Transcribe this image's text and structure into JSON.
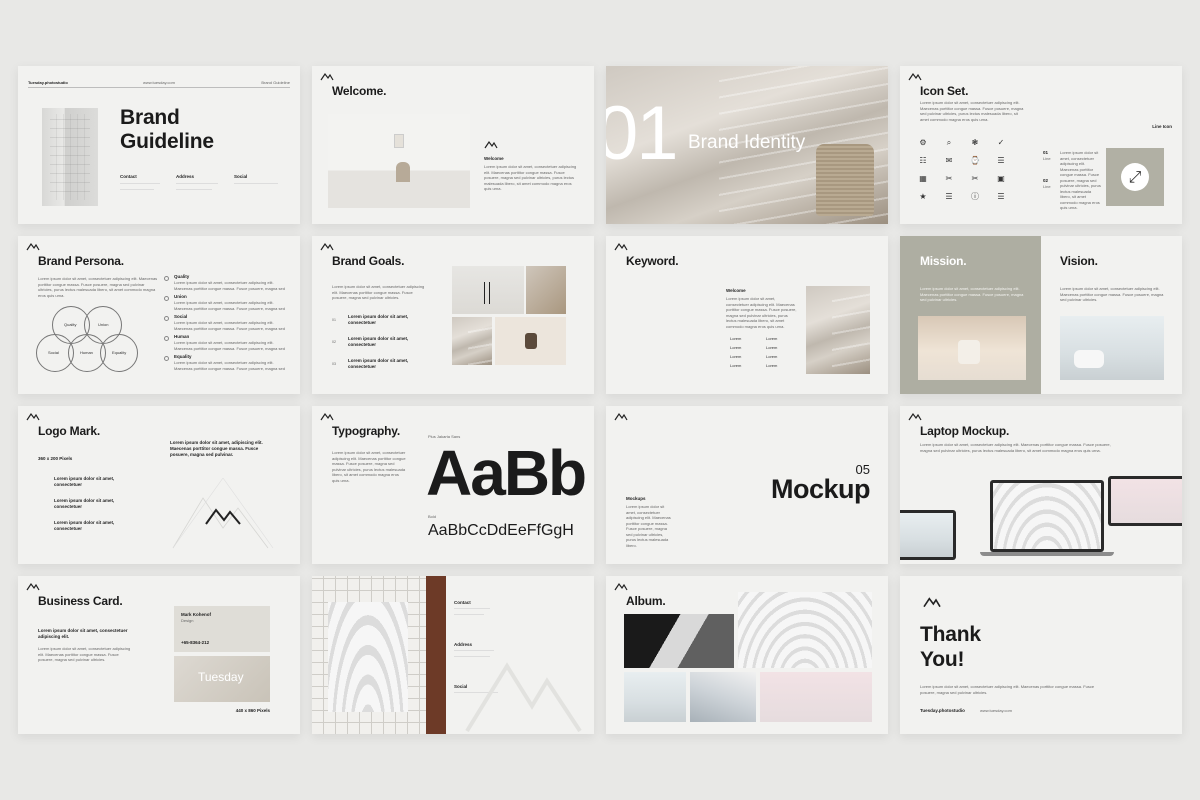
{
  "brand_guideline": {
    "header_left": "Tuesday.photostudio",
    "header_mid": "www.tuesday.com",
    "header_right": "Brand Guideline",
    "title_line1": "Brand",
    "title_line2": "Guideline",
    "contact_label": "Contact",
    "address_label": "Address",
    "social_label": "Social"
  },
  "welcome": {
    "title": "Welcome.",
    "subtitle": "Welcome",
    "body": "Lorem ipsum dolor sit amet, consectetuer adipiscing elit. Maecenas porttitor congue massa. Fusce posuere, magna sed pulvinar ultricies, purus lectus malesuada libero, sit amet commodo magna eros quis urna."
  },
  "brand_identity": {
    "number": "01",
    "title": "Brand Identity"
  },
  "icon_set": {
    "title": "Icon Set.",
    "subtitle": "Line Icon",
    "item1_num": "01",
    "item1_label": "Line",
    "item2_num": "02",
    "item2_label": "Line",
    "body": "Lorem ipsum dolor sit amet, consectetuer adipiscing elit. Maecenas porttitor congue massa. Fusce posuere, magna sed pulvinar ultricies, purus lectus malesuada libero, sit amet commodo magna eros quis urna.",
    "icons": [
      "⚙",
      "⌕",
      "❃",
      "✓",
      "☷",
      "✉",
      "⌚",
      "☰",
      "▦",
      "✂",
      "✂",
      "▣",
      "★",
      "☰",
      "ⓘ",
      "☰"
    ]
  },
  "brand_persona": {
    "title": "Brand Persona.",
    "body": "Lorem ipsum dolor sit amet, consectetuer adipiscing elit. Maecenas porttitor congue massa. Fusce posuere, magna sed pulvinar ultricies, purus lectus malesuada libero, sit amet commodo magna eros quis urna.",
    "venn": [
      "Quality",
      "Union",
      "Social",
      "Human",
      "Equality"
    ],
    "traits": [
      "Quality",
      "Union",
      "Social",
      "Human",
      "Equality"
    ]
  },
  "brand_goals": {
    "title": "Brand Goals.",
    "body": "Lorem ipsum dolor sit amet, consectetuer adipiscing elit. Maecenas porttitor congue massa. Fusce posuere, magna sed pulvinar ultricies.",
    "goal1": "Lorem ipsum dolor sit amet, consectetuer",
    "goal2": "Lorem ipsum dolor sit amet, consectetuer",
    "goal3": "Lorem ipsum dolor sit amet, consectetuer"
  },
  "keyword": {
    "title": "Keyword.",
    "subtitle": "Welcome",
    "body": "Lorem ipsum dolor sit amet, consectetuer adipiscing elit. Maecenas porttitor congue massa. Fusce posuere, magna sed pulvinar ultricies, purus lectus malesuada libero, sit amet commodo magna eros quis urna.",
    "words": [
      "Lorem",
      "Lorem",
      "Lorem",
      "Lorem",
      "Lorem",
      "Lorem",
      "Lorem",
      "Lorem"
    ]
  },
  "mission_vision": {
    "mission_title": "Mission.",
    "vision_title": "Vision.",
    "mission_body": "Lorem ipsum dolor sit amet, consectetuer adipiscing elit. Maecenas porttitor congue massa. Fusce posuere, magna sed pulvinar ultricies.",
    "vision_body": "Lorem ipsum dolor sit amet, consectetuer adipiscing elit. Maecenas porttitor congue massa. Fusce posuere, magna sed pulvinar ultricies."
  },
  "logo_mark": {
    "title": "Logo Mark.",
    "size": "360 x 200 Pixels",
    "lead": "Lorem ipsum dolor sit amet, adipiscing elit. Maecenas porttitor congue massa. Fusce posuere, magna sed pulvinar.",
    "item1": "Lorem ipsum dolor sit amet, consectetuer",
    "item2": "Lorem ipsum dolor sit amet, consectetuer",
    "item3": "Lorem ipsum dolor sit amet, consectetuer"
  },
  "typography": {
    "title": "Typography.",
    "font_name": "Plus Jakarta Sans",
    "body": "Lorem ipsum dolor sit amet, consectetuer adipiscing elit. Maecenas porttitor congue massa. Fusce posuere, magna sed pulvinar ultricies, purus lectus malesuada libero, sit amet commodo magna eros quis urna.",
    "big_sample": "AaBb",
    "weight_label": "Bold",
    "sample_line": "AaBbCcDdEeFfGgH"
  },
  "mockup": {
    "number": "05",
    "title": "Mockup",
    "subtitle": "Mockups",
    "body": "Lorem ipsum dolor sit amet, consectetuer adipiscing elit. Maecenas porttitor congue massa. Fusce posuere, magna sed pulvinar ultricies, purus lectus malesuada libero."
  },
  "laptop_mockup": {
    "title": "Laptop Mockup.",
    "body": "Lorem ipsum dolor sit amet, consectetuer adipiscing elit. Maecenas porttitor congue massa. Fusce posuere, magna sed pulvinar ultricies, purus lectus malesuada libero, sit amet commodo magna eros quis urna."
  },
  "business_card": {
    "title": "Business Card.",
    "lead": "Lorem ipsum dolor sit amet, consectetuer adipiscing elit.",
    "body": "Lorem ipsum dolor sit amet, consectetuer adipiscing elit. Maecenas porttitor congue massa. Fusce posuere, magna sed pulvinar ultricies.",
    "name": "Mark Kohenof",
    "role": "Design",
    "phone": "+65-8364-212",
    "card_brand": "Tuesday",
    "size": "440 x 860 Pixels"
  },
  "contact": {
    "contact_label": "Contact",
    "address_label": "Address",
    "social_label": "Social"
  },
  "album": {
    "title": "Album."
  },
  "thank_you": {
    "line1": "Thank",
    "line2": "You!",
    "body": "Lorem ipsum dolor sit amet, consectetuer adipiscing elit. Maecenas porttitor congue massa. Fusce posuere, magna sed pulvinar ultricies.",
    "footer_left": "Tuesday.photostudio",
    "footer_right": "www.tuesday.com"
  }
}
